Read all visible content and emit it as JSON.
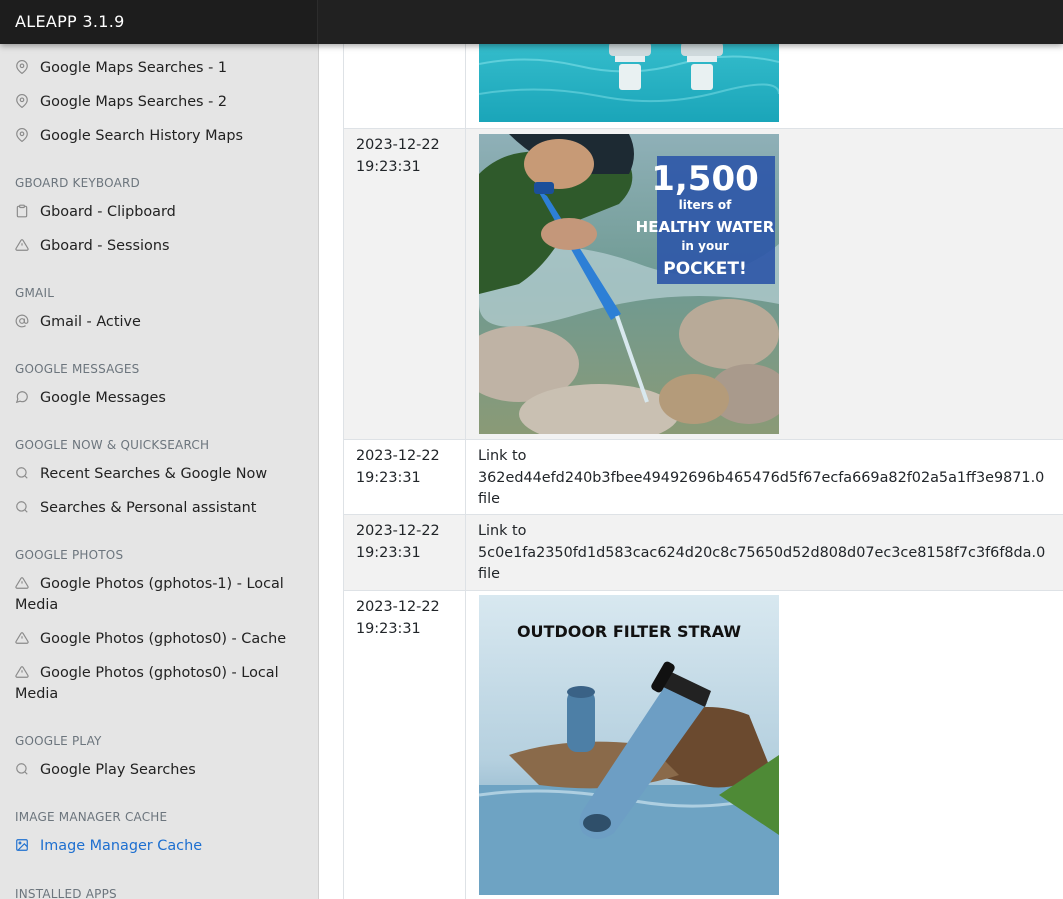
{
  "app": {
    "title": "ALEAPP 3.1.9"
  },
  "sidebar": {
    "items": [
      {
        "label": "Google Maps Searches - 1",
        "icon": "map-pin-icon"
      },
      {
        "label": "Google Maps Searches - 2",
        "icon": "map-pin-icon"
      },
      {
        "label": "Google Search History Maps",
        "icon": "map-pin-icon"
      }
    ],
    "sections": [
      {
        "title": "GBOARD KEYBOARD",
        "items": [
          {
            "label": "Gboard - Clipboard",
            "icon": "clipboard-icon"
          },
          {
            "label": "Gboard - Sessions",
            "icon": "alert-triangle-icon"
          }
        ]
      },
      {
        "title": "GMAIL",
        "items": [
          {
            "label": "Gmail - Active",
            "icon": "at-sign-icon"
          }
        ]
      },
      {
        "title": "GOOGLE MESSAGES",
        "items": [
          {
            "label": "Google Messages",
            "icon": "message-circle-icon"
          }
        ]
      },
      {
        "title": "GOOGLE NOW & QUICKSEARCH",
        "items": [
          {
            "label": "Recent Searches & Google Now",
            "icon": "search-icon"
          },
          {
            "label": "Searches & Personal assistant",
            "icon": "search-icon"
          }
        ]
      },
      {
        "title": "GOOGLE PHOTOS",
        "items": [
          {
            "label_line1": "Google Photos (gphotos-1) - Local",
            "label_line2": "Media",
            "icon": "alert-triangle-icon"
          },
          {
            "label": "Google Photos (gphotos0) - Cache",
            "icon": "alert-triangle-icon"
          },
          {
            "label_line1": "Google Photos (gphotos0) - Local",
            "label_line2": "Media",
            "icon": "alert-triangle-icon"
          }
        ]
      },
      {
        "title": "GOOGLE PLAY",
        "items": [
          {
            "label": "Google Play Searches",
            "icon": "search-icon"
          }
        ]
      },
      {
        "title": "IMAGE MANAGER CACHE",
        "items": [
          {
            "label": "Image Manager Cache",
            "icon": "image-icon",
            "active": true
          }
        ]
      },
      {
        "title": "INSTALLED APPS",
        "items": []
      }
    ]
  },
  "table": {
    "rows": [
      {
        "date": "",
        "time": "",
        "type": "image",
        "image": "water-filter-bottles-image"
      },
      {
        "date": "2023-12-22",
        "time": "19:23:31",
        "type": "image",
        "image": "person-drinking-straw-image",
        "ad_line1": "1,500",
        "ad_line2": "liters of",
        "ad_line3": "HEALTHY WATER",
        "ad_line4": "in your",
        "ad_line5": "POCKET!"
      },
      {
        "date": "2023-12-22",
        "time": "19:23:31",
        "type": "link",
        "link_prefix": "Link to",
        "hash": "362ed44efd240b3fbee49492696b465476d5f67ecfa669a82f02a5a1ff3e9871.0",
        "suffix": "file"
      },
      {
        "date": "2023-12-22",
        "time": "19:23:31",
        "type": "link",
        "link_prefix": "Link to",
        "hash": "5c0e1fa2350fd1d583cac624d20c8c75650d52d808d07ec3ce8158f7c3f6f8da.0",
        "suffix": "file"
      },
      {
        "date": "2023-12-22",
        "time": "19:23:31",
        "type": "image",
        "image": "outdoor-filter-straw-image",
        "caption": "OUTDOOR FILTER STRAW"
      }
    ]
  },
  "colors": {
    "topbar": "#212121",
    "sidebar": "#e5e5e5",
    "active": "#1d6fd0",
    "section": "#6c757d"
  }
}
